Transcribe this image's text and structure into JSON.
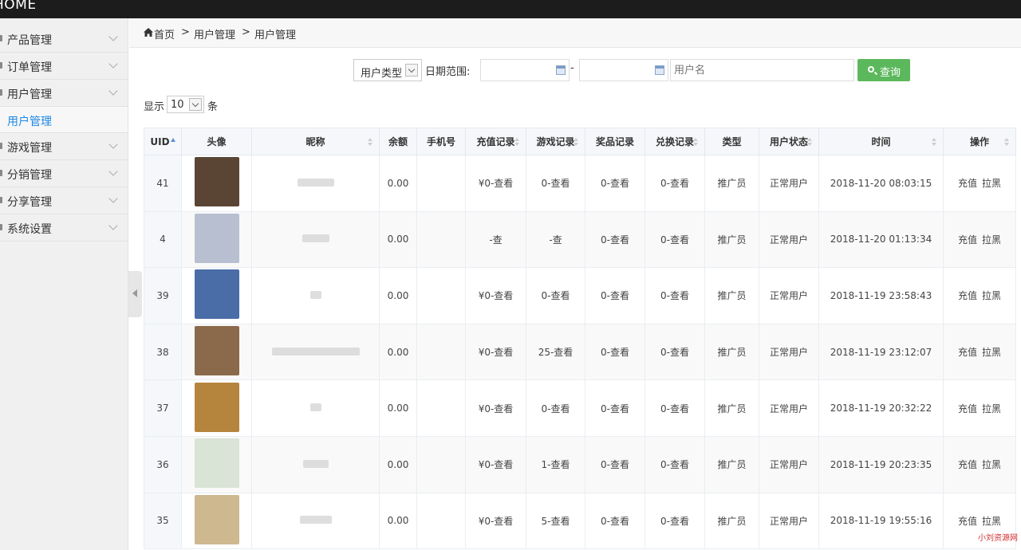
{
  "app": {
    "brand": "HOME"
  },
  "sidebar": {
    "items": [
      {
        "label": "产品管理",
        "icon": "box-icon"
      },
      {
        "label": "订单管理",
        "icon": "cart-icon"
      },
      {
        "label": "用户管理",
        "icon": "user-icon"
      },
      {
        "label": "游戏管理",
        "icon": "gamepad-icon"
      },
      {
        "label": "分销管理",
        "icon": "share-icon"
      },
      {
        "label": "分享管理",
        "icon": "link-icon"
      },
      {
        "label": "系统设置",
        "icon": "gear-icon"
      }
    ],
    "active_sub": "用户管理"
  },
  "breadcrumb": {
    "home": "首页",
    "sep": ">",
    "level1": "用户管理",
    "level2": "用户管理"
  },
  "filters": {
    "user_type": "用户类型",
    "date_range_label": "日期范围:",
    "date_dash": "-",
    "username_placeholder": "用户名",
    "search_label": "查询"
  },
  "page_length": {
    "prefix": "显示",
    "value": "10",
    "suffix": "条"
  },
  "table": {
    "columns": [
      "UID",
      "头像",
      "昵称",
      "余额",
      "手机号",
      "充值记录",
      "游戏记录",
      "奖品记录",
      "兑换记录",
      "类型",
      "用户状态",
      "时间",
      "操作"
    ],
    "rows": [
      {
        "uid": "41",
        "balance": "0.00",
        "phone": "",
        "recharge": "¥0-查看",
        "game": "0-查看",
        "prize": "0-查看",
        "exchange": "0-查看",
        "type": "推广员",
        "status": "正常用户",
        "time": "2018-11-20 08:03:15",
        "action1": "充值",
        "action2": "拉黑",
        "avatar_color": "#5a4535"
      },
      {
        "uid": "4",
        "balance": "0.00",
        "phone": "",
        "recharge": "-查",
        "game": "-查",
        "prize": "0-查看",
        "exchange": "0-查看",
        "type": "推广员",
        "status": "正常用户",
        "time": "2018-11-20 01:13:34",
        "action1": "充值",
        "action2": "拉黑",
        "avatar_color": "#b8bfd0"
      },
      {
        "uid": "39",
        "balance": "0.00",
        "phone": "",
        "recharge": "¥0-查看",
        "game": "0-查看",
        "prize": "0-查看",
        "exchange": "0-查看",
        "type": "推广员",
        "status": "正常用户",
        "time": "2018-11-19 23:58:43",
        "action1": "充值",
        "action2": "拉黑",
        "avatar_color": "#4a6da8"
      },
      {
        "uid": "38",
        "balance": "0.00",
        "phone": "",
        "recharge": "¥0-查看",
        "game": "25-查看",
        "prize": "0-查看",
        "exchange": "0-查看",
        "type": "推广员",
        "status": "正常用户",
        "time": "2018-11-19 23:12:07",
        "action1": "充值",
        "action2": "拉黑",
        "avatar_color": "#8a6a4a"
      },
      {
        "uid": "37",
        "balance": "0.00",
        "phone": "",
        "recharge": "¥0-查看",
        "game": "0-查看",
        "prize": "0-查看",
        "exchange": "0-查看",
        "type": "推广员",
        "status": "正常用户",
        "time": "2018-11-19 20:32:22",
        "action1": "充值",
        "action2": "拉黑",
        "avatar_color": "#b5853e"
      },
      {
        "uid": "36",
        "balance": "0.00",
        "phone": "",
        "recharge": "¥0-查看",
        "game": "1-查看",
        "prize": "0-查看",
        "exchange": "0-查看",
        "type": "推广员",
        "status": "正常用户",
        "time": "2018-11-19 20:23:35",
        "action1": "充值",
        "action2": "拉黑",
        "avatar_color": "#d9e3d6"
      },
      {
        "uid": "35",
        "balance": "0.00",
        "phone": "",
        "recharge": "¥0-查看",
        "game": "5-查看",
        "prize": "0-查看",
        "exchange": "0-查看",
        "type": "推广员",
        "status": "正常用户",
        "time": "2018-11-19 19:55:16",
        "action1": "充值",
        "action2": "拉黑",
        "avatar_color": "#cdb88f"
      }
    ]
  },
  "watermark": "小刘资源网"
}
